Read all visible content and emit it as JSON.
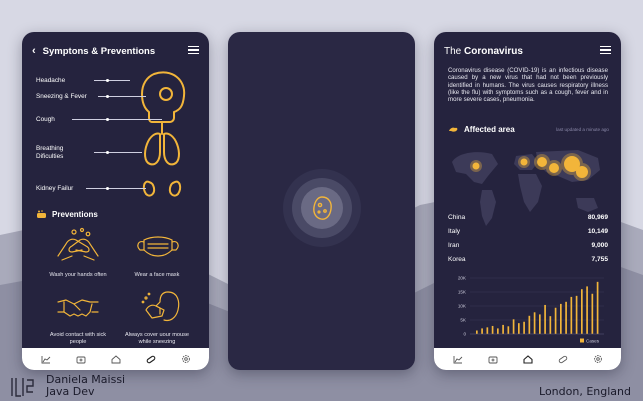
{
  "left_screen": {
    "title": "Symptons & Preventions",
    "symptoms": [
      "Headache",
      "Sneezing & Fever",
      "Cough",
      "Breathing\nDificulties",
      "Kidney Failur"
    ],
    "preventions_title": "Preventions",
    "preventions": [
      "Wash your hands often",
      "Wear a face mask",
      "Avoid contact with sick people",
      "Always cover uour mouse while sneezing"
    ]
  },
  "right_screen": {
    "title_prefix": "The ",
    "title_bold": "Coronavirus",
    "intro": "Coronavirus disease (COVID-19) is an infectious disease caused by a new virus that had not been previously identified in humans. The virus causes respiratory illness (like the flu) with symptoms such as a cough, fever and in more severe cases, pneumonia.",
    "affected_title": "Affected area",
    "last_updated": "last updated a minute ago",
    "countries": [
      {
        "name": "China",
        "value": "80,969"
      },
      {
        "name": "Italy",
        "value": "10,149"
      },
      {
        "name": "Iran",
        "value": "9,000"
      },
      {
        "name": "Korea",
        "value": "7,755"
      }
    ],
    "chart_y_ticks": [
      "20K",
      "15K",
      "10K",
      "5K",
      "0"
    ],
    "chart_legend": "Cases",
    "chart_values": [
      1,
      1.6,
      1.9,
      2.3,
      1.6,
      2.6,
      2.2,
      4.2,
      3.1,
      3.5,
      5.2,
      6.2,
      5.6,
      8.3,
      5.1,
      7.5,
      8.6,
      9.2,
      10.6,
      10.9,
      12.8,
      13.6,
      11.5,
      14.9
    ]
  },
  "caption": {
    "name": "Daniela Maissi",
    "role": "Java Dev",
    "location": "London, England"
  },
  "colors": {
    "accent": "#f2b53a",
    "screen_bg": "#25233e",
    "page_bg": "#d7d8e4"
  },
  "icons": [
    "back-arrow-icon",
    "menu-icon",
    "virus-icon",
    "globe-icon",
    "soap-icon",
    "chart-icon",
    "medkit-icon",
    "home-icon",
    "pill-icon",
    "settings-icon"
  ]
}
